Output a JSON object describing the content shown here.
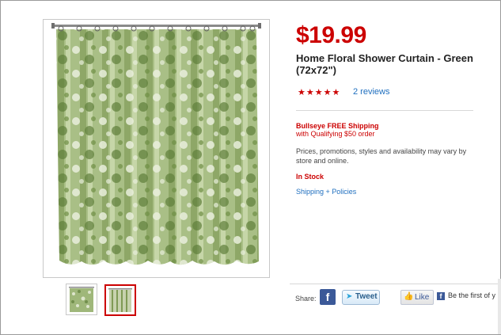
{
  "product": {
    "price": "$19.99",
    "title": "Home Floral Shower Curtain - Green (72x72\")",
    "stars": "★★★★★",
    "rating": 5,
    "reviews_link": "2 reviews"
  },
  "shipping": {
    "title": "Bullseye FREE Shipping",
    "subtitle": "with Qualifying $50 order"
  },
  "disclaimer": "Prices, promotions, styles and availability may vary by store and online.",
  "stock_status": "In Stock",
  "policies_link": "Shipping + Policies",
  "social": {
    "share_label": "Share:",
    "facebook_glyph": "f",
    "tweet_label": "Tweet",
    "like_label": "Like",
    "fb_text": "Be the first of y"
  },
  "colors": {
    "price_red": "#cc0000",
    "link_blue": "#1f6fbf",
    "curtain_green": "#9fb77a"
  },
  "icons": {
    "facebook": "facebook-icon",
    "twitter": "twitter-bird-icon",
    "like": "thumbs-up-icon"
  }
}
